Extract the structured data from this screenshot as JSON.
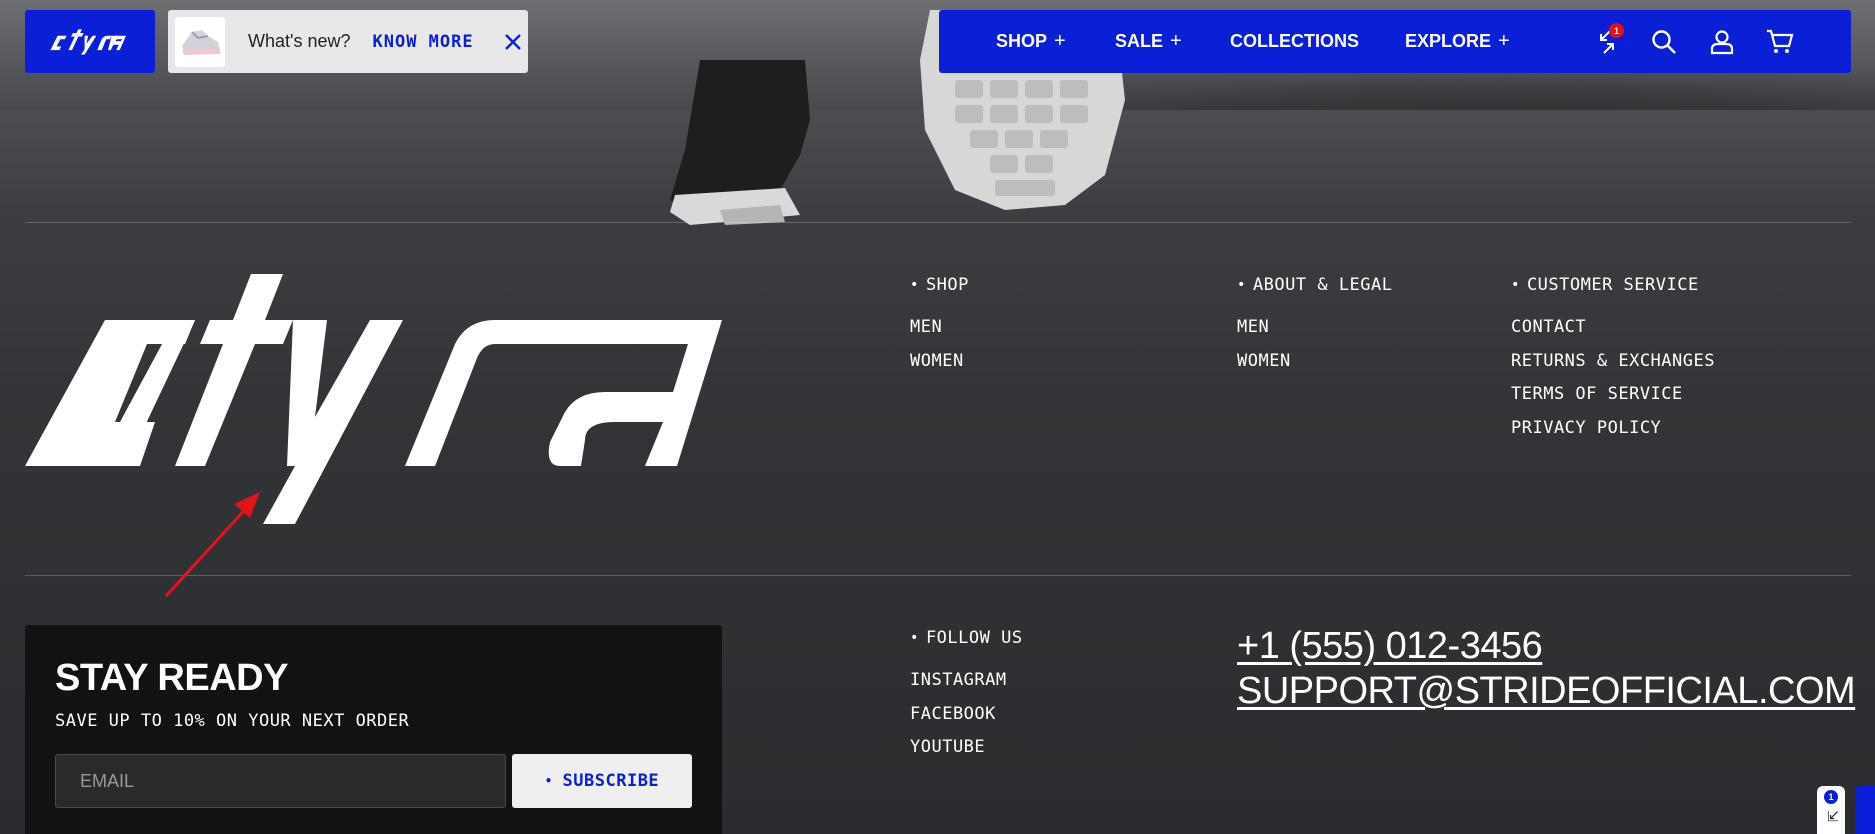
{
  "topbar": {
    "logo_alt": "styra",
    "whats_new": {
      "text": "What's new?",
      "link": "KNOW MORE"
    }
  },
  "nav": {
    "items": [
      {
        "label": "SHOP",
        "plus": "+"
      },
      {
        "label": "SALE",
        "plus": "+"
      },
      {
        "label": "COLLECTIONS",
        "plus": ""
      },
      {
        "label": "EXPLORE",
        "plus": "+"
      }
    ],
    "compare_count": "1",
    "icons": [
      "compare-icon",
      "search-icon",
      "account-icon",
      "cart-icon"
    ]
  },
  "footer": {
    "shop": {
      "title": "SHOP",
      "links": [
        "MEN",
        "WOMEN"
      ]
    },
    "about": {
      "title": "ABOUT & LEGAL",
      "links": [
        "MEN",
        "WOMEN"
      ]
    },
    "customer_service": {
      "title": "CUSTOMER SERVICE",
      "links": [
        "CONTACT",
        "RETURNS & EXCHANGES",
        "TERMS OF SERVICE",
        "PRIVACY POLICY"
      ]
    },
    "follow": {
      "title": "FOLLOW US",
      "links": [
        "INSTAGRAM",
        "FACEBOOK",
        "YOUTUBE"
      ]
    },
    "phone": "+1 (555) 012-3456",
    "email": "SUPPORT@STRIDEOFFICIAL.COM"
  },
  "newsletter": {
    "title": "STAY READY",
    "subtitle": "SAVE UP TO 10% ON YOUR NEXT ORDER",
    "email_placeholder": "EMAIL",
    "button": "SUBSCRIBE"
  },
  "side_widget": {
    "badge": "1"
  },
  "colors": {
    "brand_blue": "#0a1fd6",
    "badge_red": "#e3121a",
    "annotation_red": "#e0141a"
  }
}
